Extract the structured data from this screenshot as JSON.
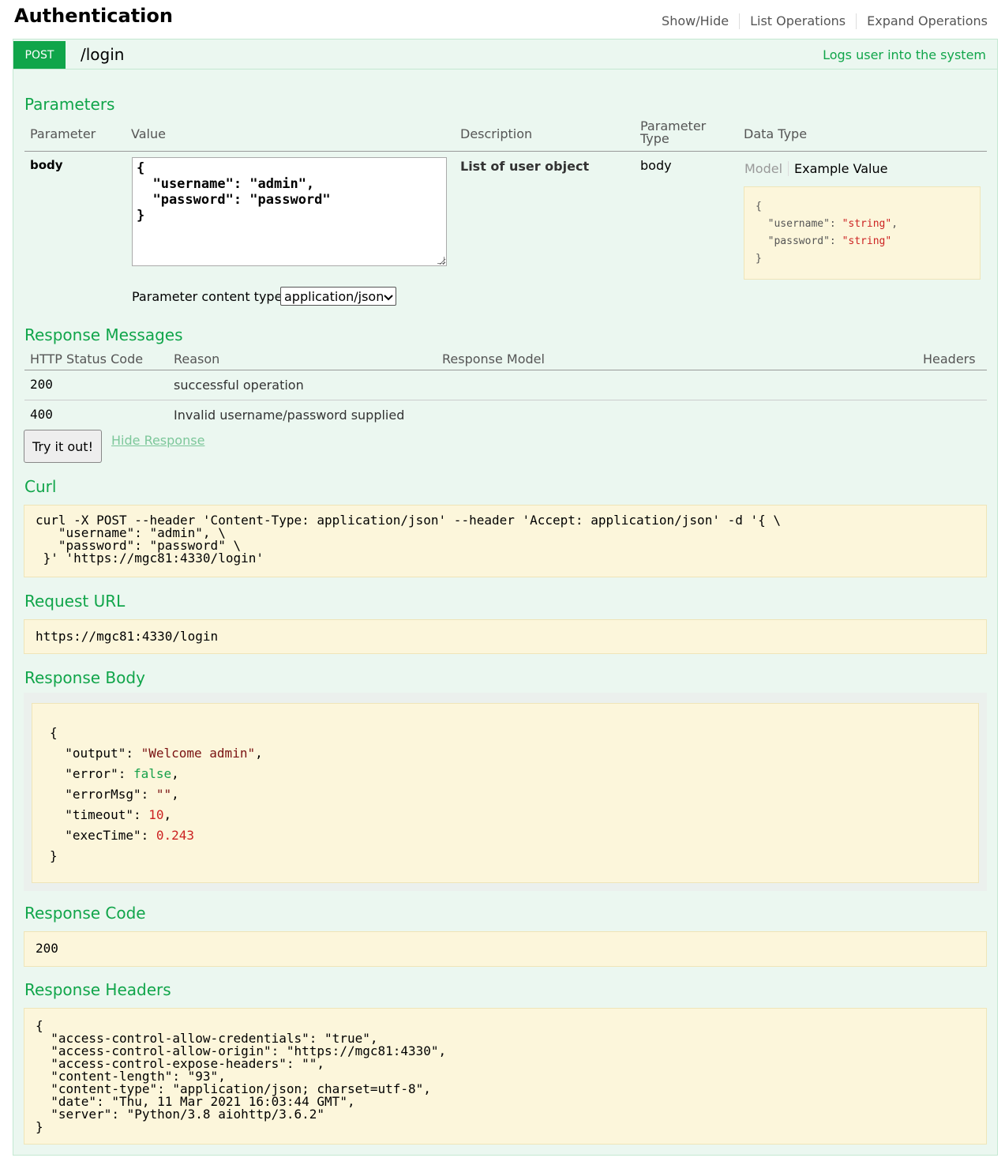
{
  "header": {
    "title": "Authentication",
    "nav": [
      "Show/Hide",
      "List Operations",
      "Expand Operations"
    ]
  },
  "operation": {
    "method": "POST",
    "path": "/login",
    "summary": "Logs user into the system"
  },
  "parameters": {
    "title": "Parameters",
    "columns": {
      "parameter": "Parameter",
      "value": "Value",
      "description": "Description",
      "type_line1": "Parameter",
      "type_line2": "Type",
      "data_type": "Data Type"
    },
    "row": {
      "name": "body",
      "value_lines": [
        "{",
        "  \"username\": \"admin\",",
        "  \"password\": \"password\"",
        "}"
      ],
      "description": "List of user object",
      "type": "body"
    },
    "model_tabs": {
      "model": "Model",
      "example": "Example Value"
    },
    "example": {
      "open": "{",
      "k1": "  \"username\": ",
      "v1": "\"string\"",
      "k2": "  \"password\": ",
      "v2": "\"string\"",
      "close": "}"
    },
    "content_type_label": "Parameter content type:",
    "content_type_value": "application/json"
  },
  "response_messages": {
    "title": "Response Messages",
    "columns": {
      "code": "HTTP Status Code",
      "reason": "Reason",
      "model": "Response Model",
      "headers": "Headers"
    },
    "rows": [
      {
        "code": "200",
        "reason": "successful operation"
      },
      {
        "code": "400",
        "reason": "Invalid username/password supplied"
      }
    ]
  },
  "actions": {
    "try_label": "Try it out!",
    "hide_label": "Hide Response"
  },
  "curl": {
    "title": "Curl",
    "lines": [
      "curl -X POST --header 'Content-Type: application/json' --header 'Accept: application/json' -d '{ \\",
      "   \"username\": \"admin\", \\",
      "   \"password\": \"password\" \\",
      " }' 'https://mgc81:4330/login'"
    ]
  },
  "request_url": {
    "title": "Request URL",
    "value": "https://mgc81:4330/login"
  },
  "response_body": {
    "title": "Response Body",
    "open": "{",
    "output_key": "  \"output\": ",
    "output_val": "\"Welcome admin\"",
    "error_key": "  \"error\": ",
    "error_val": "false",
    "errormsg_key": "  \"errorMsg\": ",
    "errormsg_val": "\"\"",
    "timeout_key": "  \"timeout\": ",
    "timeout_val": "10",
    "exectime_key": "  \"execTime\": ",
    "exectime_val": "0.243",
    "close": "}"
  },
  "response_code": {
    "title": "Response Code",
    "value": "200"
  },
  "response_headers": {
    "title": "Response Headers",
    "lines": [
      "{",
      "  \"access-control-allow-credentials\": \"true\",",
      "  \"access-control-allow-origin\": \"https://mgc81:4330\",",
      "  \"access-control-expose-headers\": \"\",",
      "  \"content-length\": \"93\",",
      "  \"content-type\": \"application/json; charset=utf-8\",",
      "  \"date\": \"Thu, 11 Mar 2021 16:03:44 GMT\",",
      "  \"server\": \"Python/3.8 aiohttp/3.6.2\"",
      "}"
    ]
  }
}
